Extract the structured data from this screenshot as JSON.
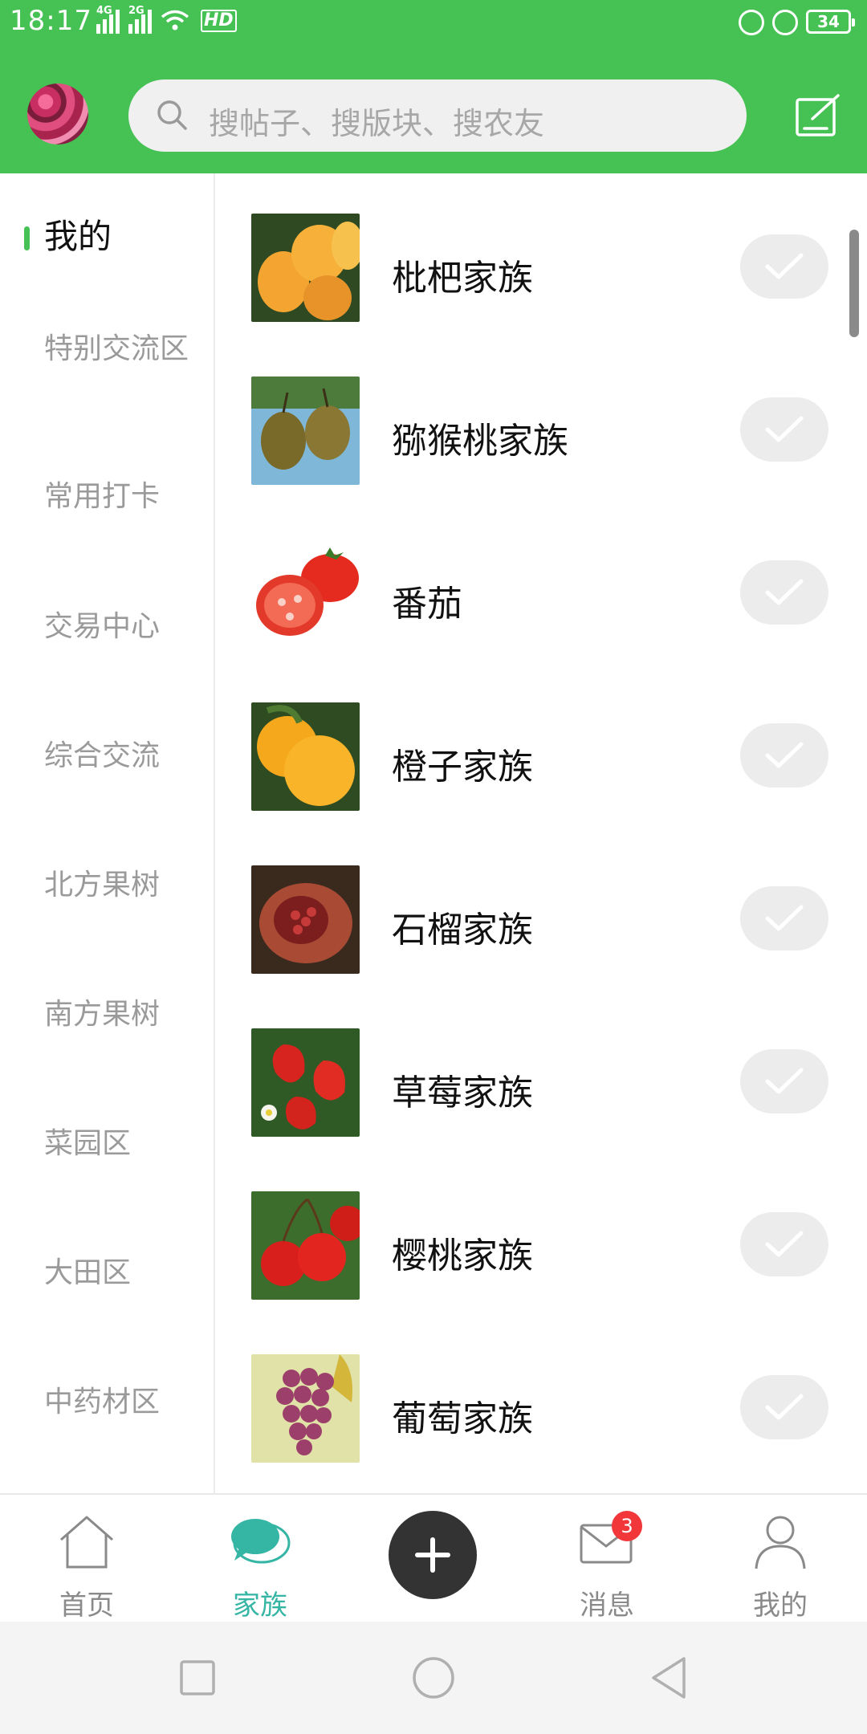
{
  "status_bar": {
    "time": "18:17",
    "network_1": "4G",
    "network_2": "2G",
    "hd_label": "HD",
    "battery": "34"
  },
  "header": {
    "search_placeholder": "搜帖子、搜版块、搜农友",
    "avatar_icon": "avatar",
    "compose_icon": "compose-icon",
    "accent_color": "#46c154"
  },
  "sidebar": {
    "categories": [
      {
        "label": "我的",
        "active": true
      },
      {
        "label": "特别交流区",
        "active": false
      },
      {
        "label": "常用打卡",
        "active": false
      },
      {
        "label": "交易中心",
        "active": false
      },
      {
        "label": "综合交流",
        "active": false
      },
      {
        "label": "北方果树",
        "active": false
      },
      {
        "label": "南方果树",
        "active": false
      },
      {
        "label": "菜园区",
        "active": false
      },
      {
        "label": "大田区",
        "active": false
      },
      {
        "label": "中药材区",
        "active": false
      }
    ]
  },
  "families": [
    {
      "name": "枇杷家族",
      "icon": "loquat-image",
      "followed": true
    },
    {
      "name": "猕猴桃家族",
      "icon": "kiwi-image",
      "followed": true
    },
    {
      "name": "番茄",
      "icon": "tomato-image",
      "followed": true
    },
    {
      "name": "橙子家族",
      "icon": "orange-image",
      "followed": true
    },
    {
      "name": "石榴家族",
      "icon": "pomegranate-image",
      "followed": true
    },
    {
      "name": "草莓家族",
      "icon": "strawberry-image",
      "followed": true
    },
    {
      "name": "樱桃家族",
      "icon": "cherry-image",
      "followed": true
    },
    {
      "name": "葡萄家族",
      "icon": "grape-image",
      "followed": true
    }
  ],
  "bottom_nav": {
    "home": "首页",
    "family": "家族",
    "messages": "消息",
    "me": "我的",
    "messages_badge": "3",
    "active_color": "#35b5a4"
  }
}
